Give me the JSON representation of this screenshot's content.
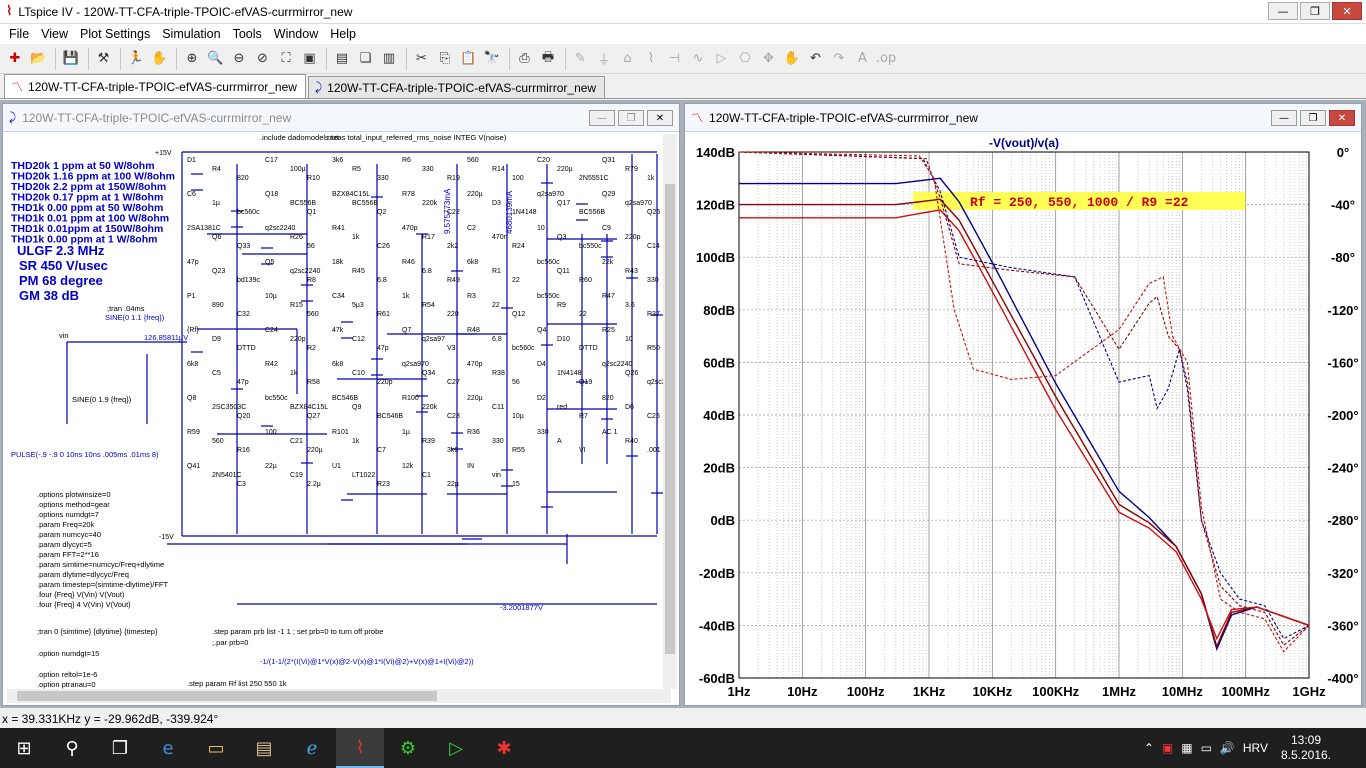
{
  "app": {
    "title": "LTspice IV - 120W-TT-CFA-triple-TPOIC-efVAS-currmirror_new"
  },
  "menu": [
    "File",
    "View",
    "Plot Settings",
    "Simulation",
    "Tools",
    "Window",
    "Help"
  ],
  "tabs": [
    {
      "label": "120W-TT-CFA-triple-TPOIC-efVAS-currmirror_new",
      "kind": "waveform",
      "active": true
    },
    {
      "label": "120W-TT-CFA-triple-TPOIC-efVAS-currmirror_new",
      "kind": "schematic",
      "active": false
    }
  ],
  "schematic_window": {
    "title": "120W-TT-CFA-triple-TPOIC-efVAS-currmirror_new",
    "thd_lines": [
      "THD20k 1 ppm at 50 W/8ohm",
      "THD20k 1.16 ppm at 100 W/8ohm",
      "THD20k 2.2 ppm at 150W/8ohm",
      "THD20k 0.17 ppm at 1 W/8ohm",
      "THD1k 0.00 ppm at 50 W/8ohm",
      "THD1k 0.01 ppm at 100 W/8ohm",
      "THD1k 0.01ppm at 150W/8ohm",
      "THD1k 0.00 ppm at 1 W/8ohm"
    ],
    "specs": [
      "ULGF 2.3 MHz",
      "SR 450 V/usec",
      "PM  68 degree",
      "GM  38 dB"
    ],
    "directives": [
      ".options plotwinsize=0",
      ".options method=gear",
      ".options numdgt=7",
      ".param Freq=20k",
      ".param numcyc=40",
      ".param dlycyc=5",
      ".param FFT=2**16",
      ".param simtime=numcyc/Freq+dlytime",
      ".param dlytime=dlycyc/Freq",
      ".param timestep=(simtime-dlytime)/FFT",
      ".four {Freq} V(Vin) V(Vout)",
      ".four {Freq} 4 V(Vin) V(Vout)"
    ],
    "tran_cmd": ";tran 0 {simtime} {dlytime} {timestep}",
    "numdgt": ".option numdgt=15",
    "reltol": ".option reltol=1e-6",
    "ptran": ".option ptranau=0",
    "step_prb": ".step param prb list -1 1 ; set prb=0 to turn off probe",
    "par_prb": ";.par prb=0",
    "step_rf": ".step param Rf list 250 550 1k",
    "include": ".include dadomodels.txt",
    "meas": ".meas total_input_referred_rms_noise INTEG V(noise)",
    "tran_small": ";tran .04ms",
    "sine_small": "SINE(0 1.1 {freq})",
    "sine_v3": "SINE(0 1.9 {freq})",
    "pulse": "PULSE(-.9 -.9 0 10ns 10ns .005ms .01ms 8)",
    "probe_formula": "-1/(1-1/(2*(I(Vi)@1*V(x)@2-V(x)@1*I(Vi)@2)+V(x)@1+I(Vi)@2))",
    "node_label_a": "126.85811µV",
    "node_label_b": "-3.2001877V",
    "i_labels": [
      "9.575773mA",
      "4680139mA"
    ],
    "plus15": "+15V",
    "minus15": "-15V",
    "vin": "vin",
    "comps": [
      {
        "t": "D1"
      },
      {
        "t": "R4"
      },
      {
        "t": "820"
      },
      {
        "t": "C17"
      },
      {
        "t": "100µ"
      },
      {
        "t": "R10"
      },
      {
        "t": "3k6"
      },
      {
        "t": "R5"
      },
      {
        "t": "330"
      },
      {
        "t": "R6"
      },
      {
        "t": "330"
      },
      {
        "t": "R19"
      },
      {
        "t": "560"
      },
      {
        "t": "R14"
      },
      {
        "t": "100"
      },
      {
        "t": "C20"
      },
      {
        "t": "220µ"
      },
      {
        "t": "2N5551C"
      },
      {
        "t": "Q31"
      },
      {
        "t": "R79"
      },
      {
        "t": "1k"
      },
      {
        "t": "C6"
      },
      {
        "t": "1µ"
      },
      {
        "t": "bc560c"
      },
      {
        "t": "Q18"
      },
      {
        "t": "BC556B"
      },
      {
        "t": "Q1"
      },
      {
        "t": "BZX84C15L"
      },
      {
        "t": "BC556B"
      },
      {
        "t": "Q2"
      },
      {
        "t": "R78"
      },
      {
        "t": "220k"
      },
      {
        "t": "C22"
      },
      {
        "t": "220µ"
      },
      {
        "t": "D3"
      },
      {
        "t": "1N4148"
      },
      {
        "t": "q2sa970"
      },
      {
        "t": "Q17"
      },
      {
        "t": "BC556B"
      },
      {
        "t": "Q29"
      },
      {
        "t": "q2sa970"
      },
      {
        "t": "Q25"
      },
      {
        "t": "2SA1381C"
      },
      {
        "t": "Q6"
      },
      {
        "t": "Q33"
      },
      {
        "t": "q2sc2240"
      },
      {
        "t": "R26"
      },
      {
        "t": "56"
      },
      {
        "t": "R41"
      },
      {
        "t": "1k"
      },
      {
        "t": "C26"
      },
      {
        "t": "470p"
      },
      {
        "t": "R17"
      },
      {
        "t": "2k2"
      },
      {
        "t": "C2"
      },
      {
        "t": "470n"
      },
      {
        "t": "R24"
      },
      {
        "t": "10"
      },
      {
        "t": "Q3"
      },
      {
        "t": "bc550c"
      },
      {
        "t": "C9"
      },
      {
        "t": "220p"
      },
      {
        "t": "C14"
      },
      {
        "t": "47p"
      },
      {
        "t": "Q23"
      },
      {
        "t": "bd139c"
      },
      {
        "t": "Q5"
      },
      {
        "t": "q2sc2240"
      },
      {
        "t": "R8"
      },
      {
        "t": "18k"
      },
      {
        "t": "R45"
      },
      {
        "t": "6.8"
      },
      {
        "t": "R46"
      },
      {
        "t": "6.8"
      },
      {
        "t": "R49"
      },
      {
        "t": "6k8"
      },
      {
        "t": "R1"
      },
      {
        "t": "22"
      },
      {
        "t": "bc560c"
      },
      {
        "t": "Q11"
      },
      {
        "t": "R60"
      },
      {
        "t": "22k"
      },
      {
        "t": "R43"
      },
      {
        "t": "330"
      },
      {
        "t": "P1"
      },
      {
        "t": "890"
      },
      {
        "t": "C32"
      },
      {
        "t": "10µ"
      },
      {
        "t": "R15"
      },
      {
        "t": "560"
      },
      {
        "t": "C34"
      },
      {
        "t": "5µ3"
      },
      {
        "t": "R61"
      },
      {
        "t": "1k"
      },
      {
        "t": "R54"
      },
      {
        "t": "220"
      },
      {
        "t": "R3"
      },
      {
        "t": "22"
      },
      {
        "t": "Q12"
      },
      {
        "t": "bc550c"
      },
      {
        "t": "R9"
      },
      {
        "t": "22"
      },
      {
        "t": "R47"
      },
      {
        "t": "3.6"
      },
      {
        "t": "R37"
      },
      {
        "t": "{Rf}"
      },
      {
        "t": "D9"
      },
      {
        "t": "DTTD"
      },
      {
        "t": "C24"
      },
      {
        "t": "220p"
      },
      {
        "t": "R2"
      },
      {
        "t": "47k"
      },
      {
        "t": "C12"
      },
      {
        "t": "47p"
      },
      {
        "t": "Q7"
      },
      {
        "t": "q2sa97"
      },
      {
        "t": "V3"
      },
      {
        "t": "R48"
      },
      {
        "t": "6.8"
      },
      {
        "t": "bc560c"
      },
      {
        "t": "Q4"
      },
      {
        "t": "D10"
      },
      {
        "t": "DTTD"
      },
      {
        "t": "R25"
      },
      {
        "t": "10"
      },
      {
        "t": "R50"
      },
      {
        "t": "6k8"
      },
      {
        "t": "C5"
      },
      {
        "t": "47p"
      },
      {
        "t": "R42"
      },
      {
        "t": "1k"
      },
      {
        "t": "R58"
      },
      {
        "t": "6k8"
      },
      {
        "t": "C10"
      },
      {
        "t": "220p"
      },
      {
        "t": "q2sa970"
      },
      {
        "t": "Q34"
      },
      {
        "t": "C27"
      },
      {
        "t": "470p"
      },
      {
        "t": "R38"
      },
      {
        "t": "56"
      },
      {
        "t": "D4"
      },
      {
        "t": "1N4148"
      },
      {
        "t": "Q19"
      },
      {
        "t": "q2sc2240"
      },
      {
        "t": "Q26"
      },
      {
        "t": "q2sc2240"
      },
      {
        "t": "Q8"
      },
      {
        "t": "2SC3503C"
      },
      {
        "t": "Q20"
      },
      {
        "t": "bc550c"
      },
      {
        "t": "BZX84C15L"
      },
      {
        "t": "Q27"
      },
      {
        "t": "BC546B"
      },
      {
        "t": "Q9"
      },
      {
        "t": "BC546B"
      },
      {
        "t": "R100"
      },
      {
        "t": "220k"
      },
      {
        "t": "C28"
      },
      {
        "t": "220µ"
      },
      {
        "t": "C11"
      },
      {
        "t": "10µ"
      },
      {
        "t": "D2"
      },
      {
        "t": "red"
      },
      {
        "t": "R7"
      },
      {
        "t": "820"
      },
      {
        "t": "D6"
      },
      {
        "t": "C25"
      },
      {
        "t": "R59"
      },
      {
        "t": "560"
      },
      {
        "t": "R16"
      },
      {
        "t": "100"
      },
      {
        "t": "C21"
      },
      {
        "t": "220µ"
      },
      {
        "t": "R101"
      },
      {
        "t": "1k"
      },
      {
        "t": "C7"
      },
      {
        "t": "1µ"
      },
      {
        "t": "R39"
      },
      {
        "t": "3k6"
      },
      {
        "t": "R36"
      },
      {
        "t": "330"
      },
      {
        "t": "R55"
      },
      {
        "t": "330"
      },
      {
        "t": "A"
      },
      {
        "t": "VI"
      },
      {
        "t": "AC 1"
      },
      {
        "t": "R40"
      },
      {
        "t": ".001"
      },
      {
        "t": "Q41"
      },
      {
        "t": "2N5401C"
      },
      {
        "t": "C3"
      },
      {
        "t": "22µ"
      },
      {
        "t": "C19"
      },
      {
        "t": "2.2µ"
      },
      {
        "t": "U1"
      },
      {
        "t": "LT1022"
      },
      {
        "t": "R23"
      },
      {
        "t": "12k"
      },
      {
        "t": "C1"
      },
      {
        "t": "22µ"
      },
      {
        "t": "IN"
      },
      {
        "t": "vin"
      },
      {
        "t": "15"
      }
    ]
  },
  "plot_window": {
    "title": "120W-TT-CFA-triple-TPOIC-efVAS-currmirror_new",
    "trace_expr": "-V(vout)/v(a)",
    "annotation": "Rf = 250, 550, 1000 / R9 =22"
  },
  "chart_data": {
    "type": "line",
    "title": "-V(vout)/v(a)",
    "x_scale": "log",
    "xlim": [
      1,
      1000000000
    ],
    "x_ticks": [
      "1Hz",
      "10Hz",
      "100Hz",
      "1KHz",
      "10KHz",
      "100KHz",
      "1MHz",
      "10MHz",
      "100MHz",
      "1GHz"
    ],
    "y_left_ticks": [
      "140dB",
      "120dB",
      "100dB",
      "80dB",
      "60dB",
      "40dB",
      "20dB",
      "0dB",
      "-20dB",
      "-40dB",
      "-60dB"
    ],
    "y_left_range_db": [
      -60,
      140
    ],
    "y_right_ticks": [
      "0°",
      "-40°",
      "-80°",
      "-120°",
      "-160°",
      "-200°",
      "-240°",
      "-280°",
      "-320°",
      "-360°",
      "-400°"
    ],
    "y_right_range_deg": [
      -400,
      0
    ],
    "grid": true,
    "series": [
      {
        "color": "#00008b",
        "kind": "magnitude",
        "points": [
          [
            1,
            128
          ],
          [
            300,
            128
          ],
          [
            1500,
            130
          ],
          [
            3000,
            121
          ],
          [
            10000,
            98
          ],
          [
            100000,
            52
          ],
          [
            1000000,
            11
          ],
          [
            3000000,
            1
          ],
          [
            8000000,
            -10
          ],
          [
            20000000,
            -28
          ],
          [
            35000000,
            -49
          ],
          [
            60000000,
            -36
          ],
          [
            150000000,
            -33
          ],
          [
            1000000000,
            -40
          ]
        ]
      },
      {
        "color": "#8b0000",
        "kind": "magnitude",
        "points": [
          [
            1,
            120
          ],
          [
            300,
            120
          ],
          [
            1500,
            122
          ],
          [
            3000,
            114
          ],
          [
            10000,
            91
          ],
          [
            100000,
            47
          ],
          [
            1000000,
            6
          ],
          [
            3000000,
            -1
          ],
          [
            8000000,
            -10
          ],
          [
            20000000,
            -28
          ],
          [
            35000000,
            -48
          ],
          [
            60000000,
            -35
          ],
          [
            150000000,
            -33
          ],
          [
            1000000000,
            -40
          ]
        ]
      },
      {
        "color": "#cc1111",
        "kind": "magnitude",
        "points": [
          [
            1,
            115
          ],
          [
            300,
            115
          ],
          [
            1500,
            118
          ],
          [
            3000,
            110
          ],
          [
            10000,
            87
          ],
          [
            100000,
            42
          ],
          [
            1000000,
            3
          ],
          [
            3000000,
            -3
          ],
          [
            8000000,
            -12
          ],
          [
            20000000,
            -30
          ],
          [
            35000000,
            -45
          ],
          [
            60000000,
            -34
          ],
          [
            150000000,
            -33
          ],
          [
            1000000000,
            -40
          ]
        ]
      },
      {
        "color": "#00008b",
        "kind": "phase",
        "dashed": true,
        "points": [
          [
            1,
            0
          ],
          [
            800,
            -5
          ],
          [
            1500,
            -30
          ],
          [
            3000,
            -80
          ],
          [
            20000,
            -88
          ],
          [
            200000,
            -95
          ],
          [
            1000000,
            -175
          ],
          [
            3000000,
            -170
          ],
          [
            4000000,
            -195
          ],
          [
            6000000,
            -180
          ],
          [
            9000000,
            -150
          ],
          [
            12000000,
            -180
          ],
          [
            20000000,
            -280
          ],
          [
            40000000,
            -320
          ],
          [
            80000000,
            -340
          ],
          [
            200000000,
            -345
          ],
          [
            400000000,
            -370
          ],
          [
            1000000000,
            -360
          ]
        ]
      },
      {
        "color": "#8b0000",
        "kind": "phase",
        "dashed": true,
        "points": [
          [
            1,
            0
          ],
          [
            900,
            -5
          ],
          [
            1500,
            -35
          ],
          [
            3000,
            -85
          ],
          [
            20000,
            -90
          ],
          [
            200000,
            -95
          ],
          [
            1000000,
            -150
          ],
          [
            3000000,
            -115
          ],
          [
            4000000,
            -110
          ],
          [
            6000000,
            -140
          ],
          [
            9000000,
            -150
          ],
          [
            12000000,
            -175
          ],
          [
            20000000,
            -280
          ],
          [
            40000000,
            -330
          ],
          [
            80000000,
            -345
          ],
          [
            200000000,
            -350
          ],
          [
            400000000,
            -375
          ],
          [
            1000000000,
            -360
          ]
        ]
      },
      {
        "color": "#cc1111",
        "kind": "phase",
        "dashed": true,
        "points": [
          [
            1,
            0
          ],
          [
            700,
            -3
          ],
          [
            1200,
            -20
          ],
          [
            2500,
            -120
          ],
          [
            5000,
            -165
          ],
          [
            20000,
            -173
          ],
          [
            100000,
            -170
          ],
          [
            1000000,
            -135
          ],
          [
            3000000,
            -100
          ],
          [
            5000000,
            -95
          ],
          [
            7000000,
            -140
          ],
          [
            12000000,
            -160
          ],
          [
            20000000,
            -270
          ],
          [
            40000000,
            -340
          ],
          [
            80000000,
            -350
          ],
          [
            200000000,
            -355
          ],
          [
            400000000,
            -380
          ],
          [
            1000000000,
            -360
          ]
        ]
      }
    ]
  },
  "status": {
    "cursor": "x = 39.331KHz   y = -29.962dB, -339.924°"
  },
  "taskbar": {
    "lang": "HRV",
    "time": "13:09",
    "date": "8.5.2016."
  }
}
